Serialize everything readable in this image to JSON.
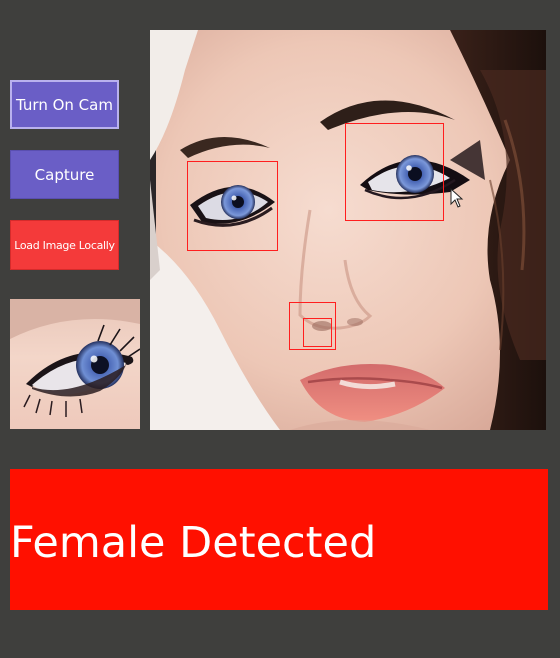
{
  "controls": {
    "turn_on_cam_label": "Turn On Cam",
    "capture_label": "Capture",
    "load_image_label": "Load Image Locally"
  },
  "result": {
    "text": "Female Detected"
  },
  "colors": {
    "background": "#3f3f3d",
    "button_primary": "#6a5ec6",
    "button_load": "#f43a3a",
    "detection_box": "#ff1e1e",
    "result_banner": "#ff1000"
  },
  "icons": {
    "cursor": "mouse-pointer-icon"
  }
}
